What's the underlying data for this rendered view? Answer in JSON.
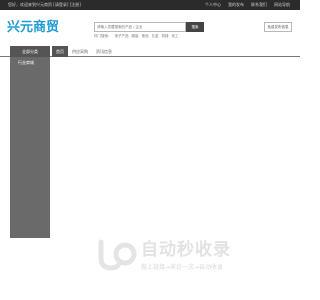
{
  "topbar": {
    "welcome": "您好，欢迎来到兴元商贸 [请登录] [注册]",
    "links": [
      "个人中心",
      "我的发布",
      "联系我们",
      "网站导航"
    ]
  },
  "logo": {
    "text": "兴元商贸"
  },
  "search": {
    "placeholder": "请输入您要搜索的产品 / 企业",
    "button": "搜索"
  },
  "hot_searches": [
    "热门搜索：",
    "电子产品",
    "服装",
    "食品",
    "五金",
    "机械",
    "化工"
  ],
  "publish_button": "免费发布信息",
  "nav": {
    "category_label": "全部分类",
    "tabs": [
      {
        "label": "首页",
        "active": true
      },
      {
        "label": "供应采购",
        "active": false
      },
      {
        "label": "资讯信息",
        "active": false
      }
    ]
  },
  "sidebar": {
    "items": [
      "行业商城"
    ]
  },
  "watermark": {
    "title": "自动秒收录",
    "subtitle": "做上链接→来访一次→自动收录"
  }
}
